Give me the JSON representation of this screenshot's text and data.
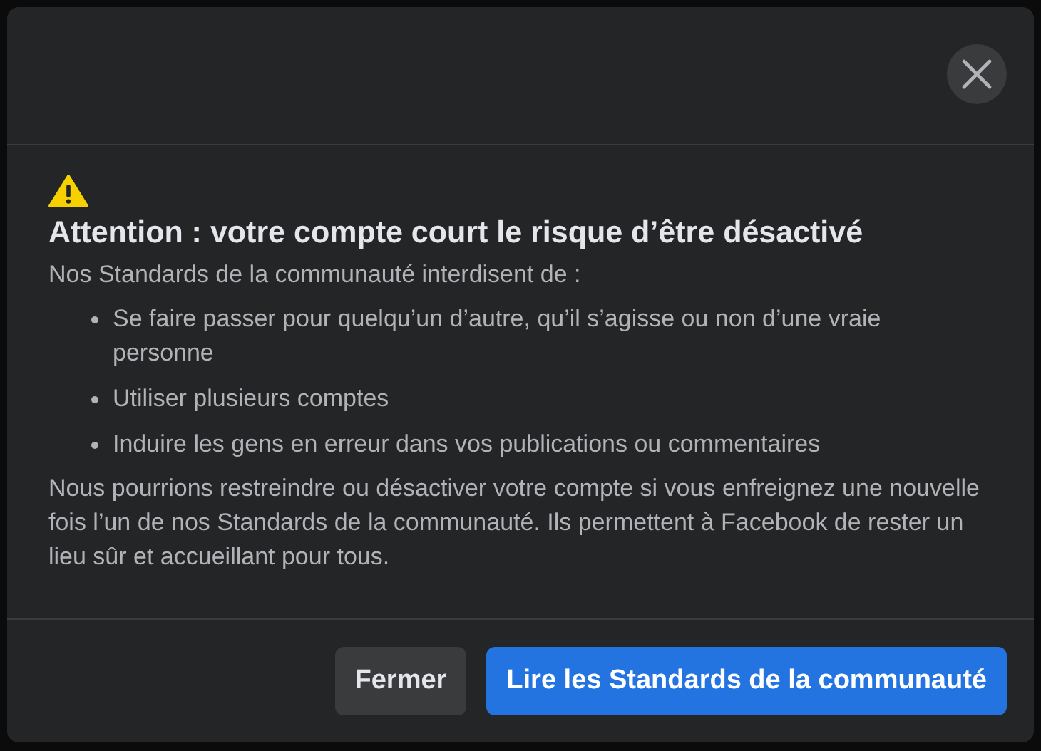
{
  "dialog": {
    "title": "Attention : votre compte court le risque d’être désactivé",
    "intro": "Nos Standards de la communauté interdisent de :",
    "rules": [
      "Se faire passer pour quelqu’un d’autre, qu’il s’agisse ou non d’une vraie personne",
      "Utiliser plusieurs comptes",
      "Induire les gens en erreur dans vos publications ou commentaires"
    ],
    "note": "Nous pourrions restreindre ou désactiver votre compte si vous enfreignez une nouvelle fois l’un de nos Standards de la communauté. Ils permettent à Facebook de rester un lieu sûr et accueillant pour tous.",
    "buttons": [
      {
        "label": "Fermer",
        "kind": "secondary"
      },
      {
        "label": "Lire les Standards de la communauté",
        "kind": "primary"
      }
    ]
  }
}
